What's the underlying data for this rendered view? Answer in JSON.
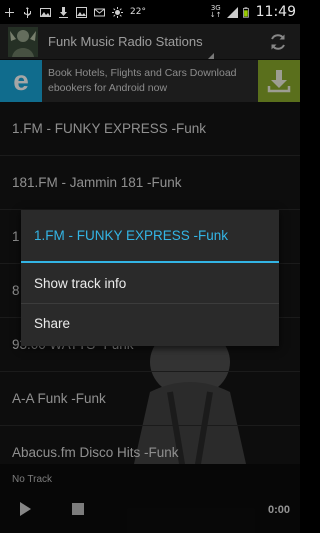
{
  "status_bar": {
    "temperature": "22°",
    "network": [
      "3G",
      "↓↑"
    ],
    "battery": "",
    "time": "11:49"
  },
  "action_bar": {
    "title": "Funk Music Radio Stations",
    "icons": {
      "app": "app-logo-icon",
      "refresh": "refresh-icon"
    }
  },
  "ad": {
    "logo_letter": "e",
    "text": "Book Hotels, Flights and Cars Download ebookers for Android now",
    "colors": {
      "logo_bg": "#1aa7d9",
      "download_bg": "#8bab2c"
    }
  },
  "stations": [
    "1.FM - FUNKY EXPRESS -Funk",
    "181.FM - Jammin 181 -Funk",
    "1",
    "8",
    "93.00 WATTS -Funk",
    "A-A Funk -Funk",
    "Abacus.fm Disco Hits -Funk"
  ],
  "player": {
    "now_playing": "No Track",
    "time": "0:00"
  },
  "context_menu": {
    "title": "1.FM - FUNKY EXPRESS -Funk",
    "items": [
      "Show track info",
      "Share"
    ],
    "accent": "#33b5e5"
  }
}
